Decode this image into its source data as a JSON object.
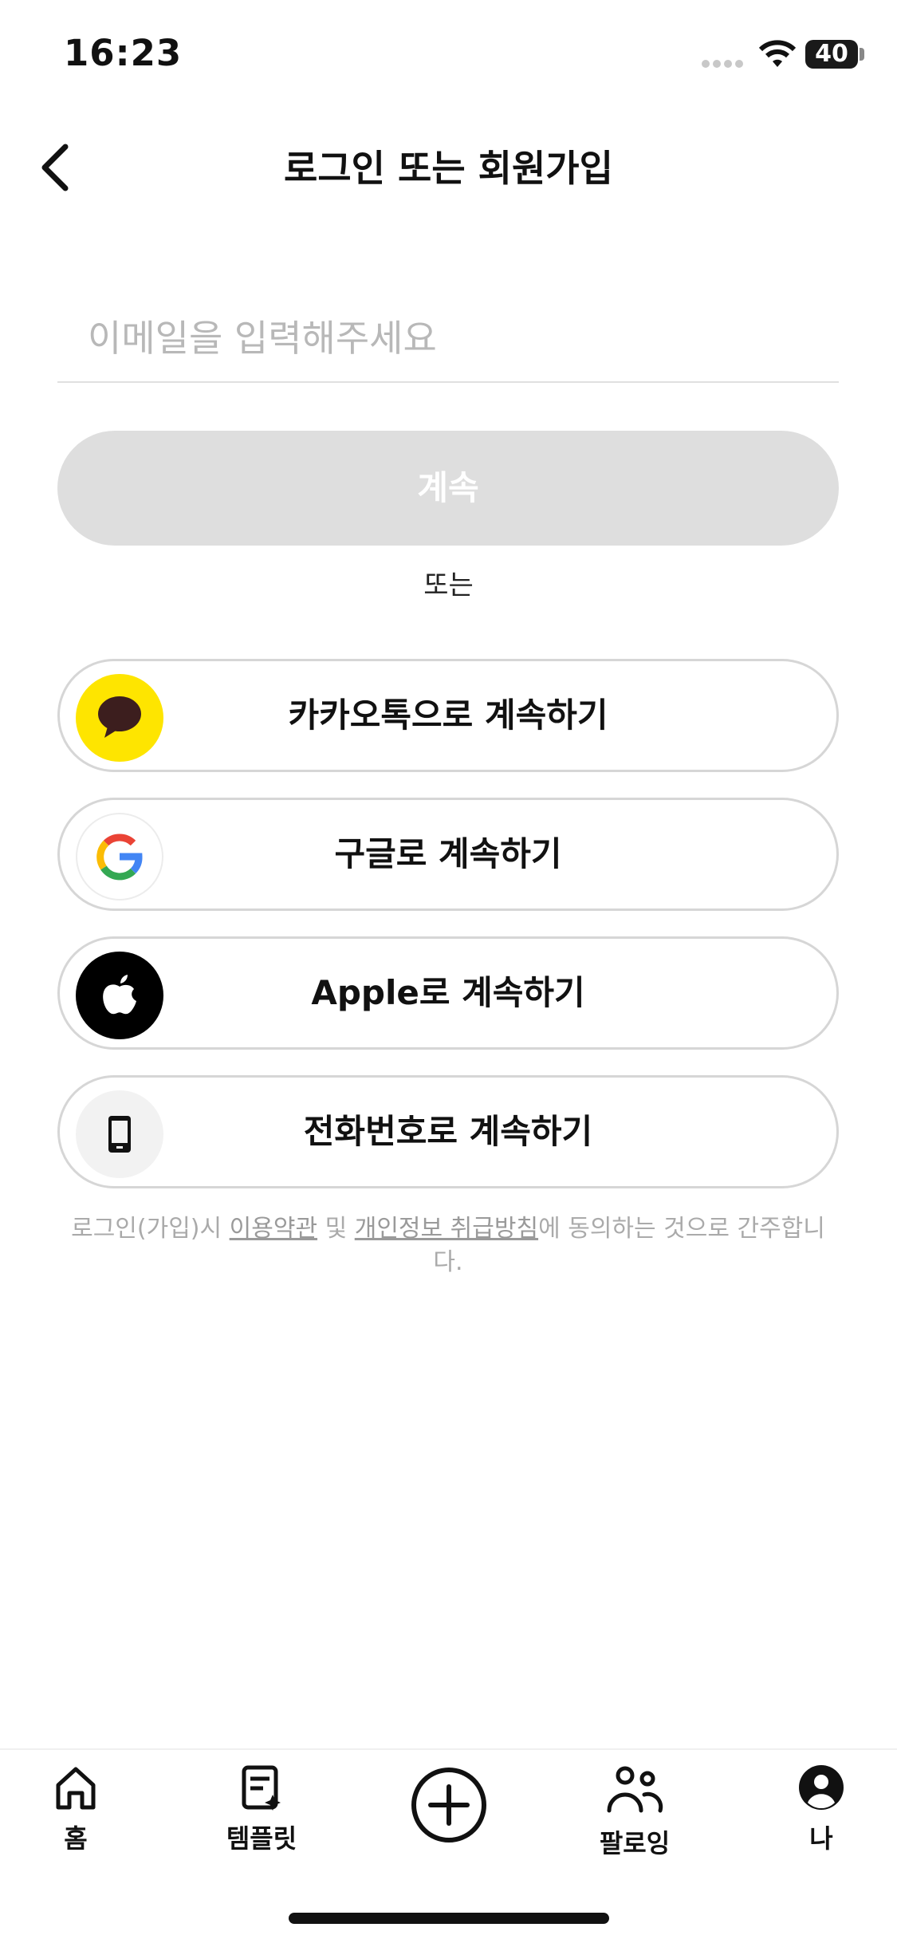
{
  "status_bar": {
    "time": "16:23",
    "battery": "40"
  },
  "header": {
    "title": "로그인 또는 회원가입"
  },
  "email": {
    "placeholder": "이메일을 입력해주세요"
  },
  "continue_label": "계속",
  "or_label": "또는",
  "social": [
    {
      "label": "카카오톡으로 계속하기",
      "icon": "kakaotalk-icon",
      "color": "#FEE500"
    },
    {
      "label": "구글로 계속하기",
      "icon": "google-icon",
      "color": "#ffffff"
    },
    {
      "label": "Apple로 계속하기",
      "icon": "apple-icon",
      "color": "#000000"
    },
    {
      "label": "전화번호로 계속하기",
      "icon": "phone-icon",
      "color": "#f2f2f2"
    }
  ],
  "terms": {
    "prefix": "로그인(가입)시 ",
    "terms_link": "이용약관",
    "and": " 및 ",
    "privacy_link": "개인정보 취급방침",
    "suffix": "에 동의하는 것으로 간주합니다."
  },
  "nav": [
    {
      "label": "홈",
      "icon": "home-icon"
    },
    {
      "label": "템플릿",
      "icon": "template-icon"
    },
    {
      "label": "",
      "icon": "add-icon"
    },
    {
      "label": "팔로잉",
      "icon": "following-icon"
    },
    {
      "label": "나",
      "icon": "profile-icon"
    }
  ]
}
